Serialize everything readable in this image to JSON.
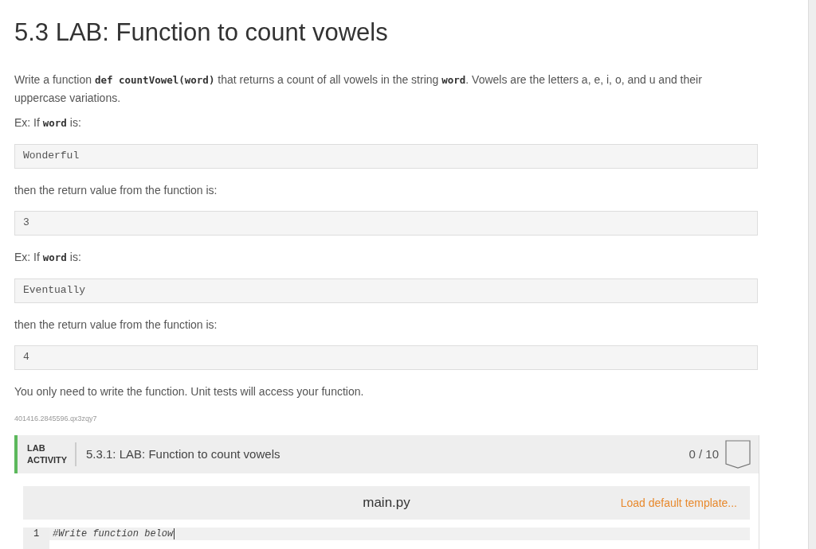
{
  "title": "5.3 LAB: Function to count vowels",
  "content": [
    {
      "kind": "paragraph",
      "parts": [
        {
          "kind": "text",
          "text": "Write a function "
        },
        {
          "kind": "code",
          "text": "def countVowel(word)"
        },
        {
          "kind": "text",
          "text": " that returns a count of all vowels in the string "
        },
        {
          "kind": "code",
          "text": "word"
        },
        {
          "kind": "text",
          "text": ". Vowels are the letters a, e, i, o, and u and their uppercase variations."
        }
      ]
    },
    {
      "kind": "paragraph",
      "parts": [
        {
          "kind": "text",
          "text": "Ex: If "
        },
        {
          "kind": "code",
          "text": "word"
        },
        {
          "kind": "text",
          "text": " is:"
        }
      ]
    },
    {
      "kind": "code_block",
      "text": "Wonderful"
    },
    {
      "kind": "paragraph",
      "parts": [
        {
          "kind": "text",
          "text": "then the return value from the function is:"
        }
      ]
    },
    {
      "kind": "code_block",
      "text": "3"
    },
    {
      "kind": "paragraph",
      "parts": [
        {
          "kind": "text",
          "text": "Ex: If "
        },
        {
          "kind": "code",
          "text": "word"
        },
        {
          "kind": "text",
          "text": " is:"
        }
      ]
    },
    {
      "kind": "code_block",
      "text": "Eventually"
    },
    {
      "kind": "paragraph",
      "parts": [
        {
          "kind": "text",
          "text": "then the return value from the function is:"
        }
      ]
    },
    {
      "kind": "code_block",
      "text": "4"
    },
    {
      "kind": "paragraph",
      "parts": [
        {
          "kind": "text",
          "text": "You only need to write the function. Unit tests will access your function."
        }
      ]
    }
  ],
  "activity_id": "401416.2845596.qx3zqy7",
  "lab": {
    "tag": "LAB ACTIVITY",
    "title": "5.3.1: LAB: Function to count vowels",
    "score": "0 / 10",
    "editor": {
      "filename": "main.py",
      "template_link": "Load default template...",
      "lines": [
        {
          "number": "1",
          "code": "#Write function below"
        }
      ]
    }
  }
}
